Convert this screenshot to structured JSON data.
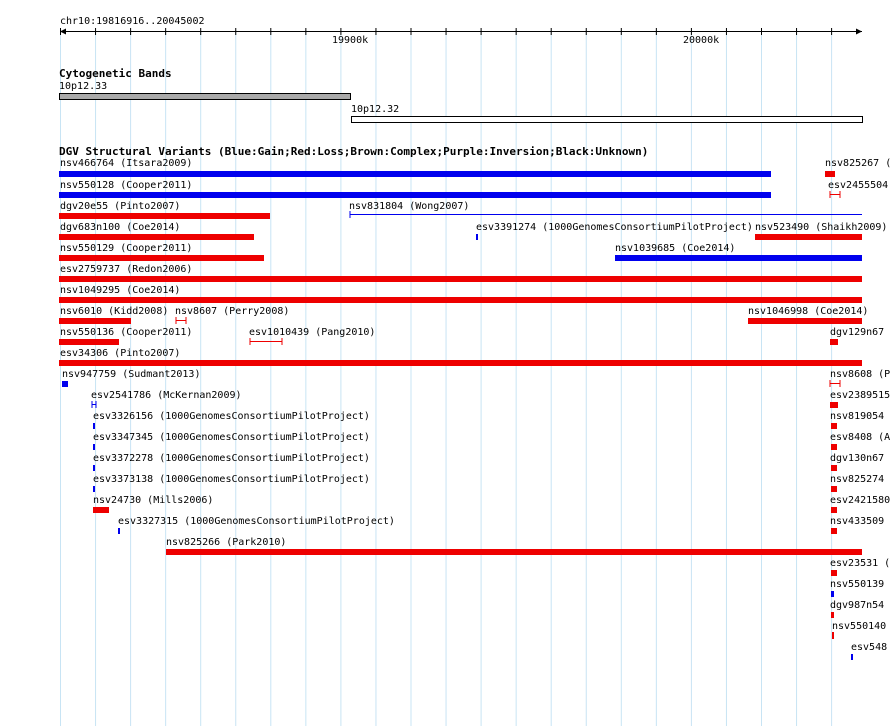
{
  "ruler": {
    "locus": "chr10:19816916..20045002",
    "ticks": [
      "19900k",
      "20000k"
    ]
  },
  "cytobands": {
    "title": "Cytogenetic Bands",
    "band1": "10p12.33",
    "band2": "10p12.32"
  },
  "dgv": {
    "title": "DGV Structural Variants (Blue:Gain;Red:Loss;Brown:Complex;Purple:Inversion;Black:Unknown)",
    "colors": {
      "gain": "#0000ee",
      "loss": "#ee0000",
      "gain_line": "#0000ee"
    },
    "variants": [
      {
        "label": "nsv466764 (Itsara2009)",
        "type": "gain"
      },
      {
        "label": "nsv825267 (",
        "type": "loss"
      },
      {
        "label": "nsv550128 (Cooper2011)",
        "type": "gain"
      },
      {
        "label": "esv2455504",
        "type": "loss"
      },
      {
        "label": "dgv20e55 (Pinto2007)",
        "type": "loss"
      },
      {
        "label": "nsv831804 (Wong2007)",
        "type": "gain"
      },
      {
        "label": "dgv683n100 (Coe2014)",
        "type": "loss"
      },
      {
        "label": "esv3391274 (1000GenomesConsortiumPilotProject)",
        "type": "gain"
      },
      {
        "label": "nsv523490 (Shaikh2009)",
        "type": "loss"
      },
      {
        "label": "nsv550129 (Cooper2011)",
        "type": "loss"
      },
      {
        "label": "nsv1039685 (Coe2014)",
        "type": "gain"
      },
      {
        "label": "esv2759737 (Redon2006)",
        "type": "loss"
      },
      {
        "label": "nsv1049295 (Coe2014)",
        "type": "loss"
      },
      {
        "label": "nsv6010 (Kidd2008)",
        "type": "loss"
      },
      {
        "label": "nsv8607 (Perry2008)",
        "type": "loss"
      },
      {
        "label": "nsv1046998 (Coe2014)",
        "type": "loss"
      },
      {
        "label": "nsv550136 (Cooper2011)",
        "type": "loss"
      },
      {
        "label": "esv1010439 (Pang2010)",
        "type": "loss"
      },
      {
        "label": "dgv129n67",
        "type": "loss"
      },
      {
        "label": "esv34306 (Pinto2007)",
        "type": "loss"
      },
      {
        "label": "nsv947759 (Sudmant2013)",
        "type": "gain"
      },
      {
        "label": "nsv8608 (P",
        "type": "loss"
      },
      {
        "label": "esv2541786 (McKernan2009)",
        "type": "gain"
      },
      {
        "label": "esv2389515",
        "type": "loss"
      },
      {
        "label": "esv3326156 (1000GenomesConsortiumPilotProject)",
        "type": "gain"
      },
      {
        "label": "nsv819054",
        "type": "loss"
      },
      {
        "label": "esv3347345 (1000GenomesConsortiumPilotProject)",
        "type": "gain"
      },
      {
        "label": "esv8408 (A",
        "type": "loss"
      },
      {
        "label": "esv3372278 (1000GenomesConsortiumPilotProject)",
        "type": "gain"
      },
      {
        "label": "dgv130n67",
        "type": "loss"
      },
      {
        "label": "esv3373138 (1000GenomesConsortiumPilotProject)",
        "type": "gain"
      },
      {
        "label": "nsv825274",
        "type": "loss"
      },
      {
        "label": "nsv24730 (Mills2006)",
        "type": "loss"
      },
      {
        "label": "esv2421580",
        "type": "loss"
      },
      {
        "label": "esv3327315 (1000GenomesConsortiumPilotProject)",
        "type": "gain"
      },
      {
        "label": "nsv433509",
        "type": "loss"
      },
      {
        "label": "nsv825266 (Park2010)",
        "type": "loss"
      },
      {
        "label": "esv23531 (",
        "type": "loss"
      },
      {
        "label": "nsv550139",
        "type": "gain"
      },
      {
        "label": "dgv987n54",
        "type": "loss"
      },
      {
        "label": "nsv550140",
        "type": "loss"
      },
      {
        "label": "esv548",
        "type": "gain"
      }
    ]
  }
}
